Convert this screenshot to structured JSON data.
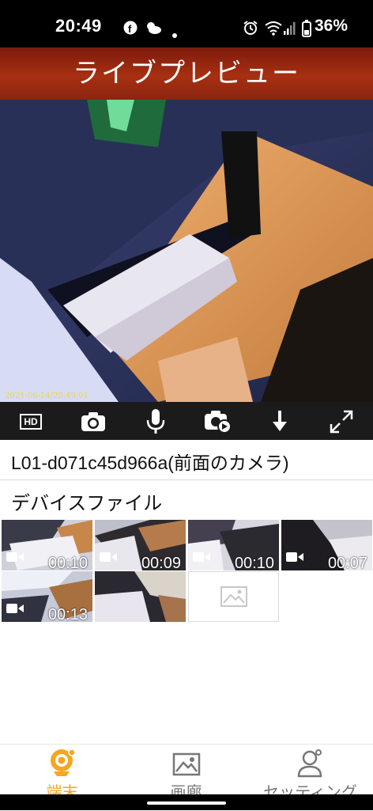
{
  "status_bar": {
    "time": "20:49",
    "battery": "36%",
    "icons": [
      "facebook-icon",
      "weather-icon",
      "dot-icon",
      "alarm-icon",
      "wifi-icon",
      "signal-icon",
      "battery-icon"
    ]
  },
  "header": {
    "title": "ライブプレビュー"
  },
  "preview": {
    "timestamp": "2021-06-14/20:49:01"
  },
  "toolbar": {
    "items": [
      {
        "name": "hd",
        "label": "HD"
      },
      {
        "name": "snapshot",
        "icon": "camera-icon"
      },
      {
        "name": "microphone",
        "icon": "mic-icon"
      },
      {
        "name": "record",
        "icon": "record-icon"
      },
      {
        "name": "download",
        "icon": "download-icon"
      },
      {
        "name": "fullscreen",
        "icon": "expand-icon"
      }
    ]
  },
  "device": {
    "name": "L01-d071c45d966a(前面のカメラ)"
  },
  "files": {
    "section_title": "デバイスファイル",
    "items": [
      {
        "duration": "00:10"
      },
      {
        "duration": "00:09"
      },
      {
        "duration": "00:10"
      },
      {
        "duration": "00:07"
      },
      {
        "duration": "00:13"
      },
      {
        "duration": ""
      },
      {
        "duration": ""
      }
    ]
  },
  "bottom_nav": {
    "items": [
      {
        "label": "端末",
        "active": true,
        "icon": "webcam-icon"
      },
      {
        "label": "画廊",
        "active": false,
        "icon": "gallery-icon"
      },
      {
        "label": "セッティング",
        "active": false,
        "icon": "settings-person-icon"
      }
    ],
    "active_color": "#f5a623",
    "inactive_color": "#777777"
  }
}
